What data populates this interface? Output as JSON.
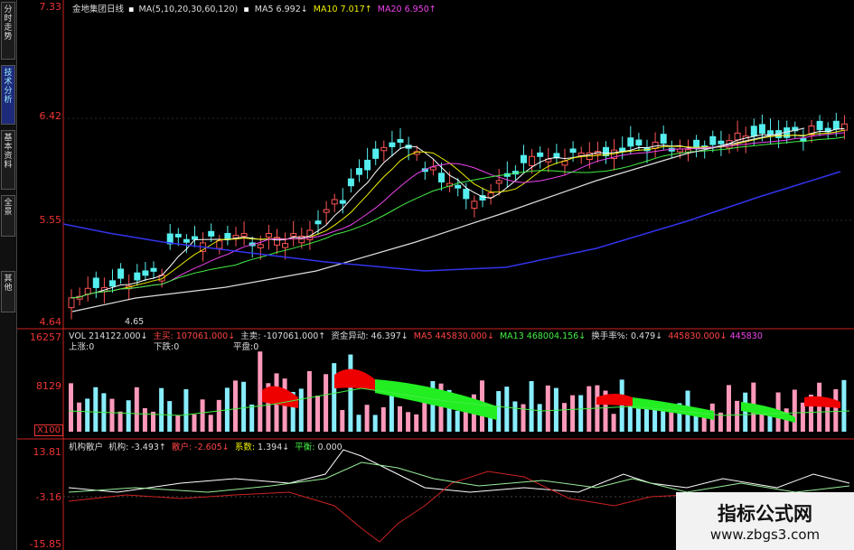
{
  "tabs": [
    {
      "label": "分时走势",
      "active": false
    },
    {
      "label": "技术分析",
      "active": true
    },
    {
      "label": "基本资料",
      "active": false
    },
    {
      "label": "全景",
      "active": false
    },
    {
      "label": "其他",
      "active": false
    }
  ],
  "price_panel": {
    "title": "金地集团日线",
    "ma_params": "MA(5,10,20,30,60,120)",
    "ma5": "MA5  6.992↓",
    "ma10": "MA10  7.017↑",
    "ma20": "MA20  6.950↑",
    "y_labels": [
      "7.33",
      "6.42",
      "5.55",
      "4.64"
    ],
    "low_marker": "4.65"
  },
  "volume_panel": {
    "vol": "VOL  214122.000↓",
    "main_buy_label": "主买:",
    "main_buy": "107061.000↓",
    "main_sell_label": "主卖:",
    "main_sell": "-107061.000↑",
    "fund_label": "资金异动:",
    "fund": "46.397↓",
    "ma5": "MA5  445830.000↓",
    "ma13": "MA13  468004.156↓",
    "turnover_label": "换手率%:",
    "turnover": "0.479↓",
    "right_value": "445830.000↓",
    "right_value2": "445830",
    "up_label": "上涨:0",
    "down_label": "下跌:0",
    "flat_label": "平盘:0",
    "y_labels": [
      "16257",
      "8129"
    ],
    "unit": "X100"
  },
  "indicator_panel": {
    "name": "机构散户",
    "inst_label": "机构:",
    "inst": "-3.493↑",
    "retail_label": "散户:",
    "retail": "-2.605↓",
    "coef_label": "系数:",
    "coef": "1.394↓",
    "balance_label": "平衡:",
    "balance": "0.000",
    "y_labels": [
      "13.81",
      "-3.16",
      "-15.85"
    ]
  },
  "watermark": {
    "title": "指标公式网",
    "url": "www.zbgs3.com"
  }
}
